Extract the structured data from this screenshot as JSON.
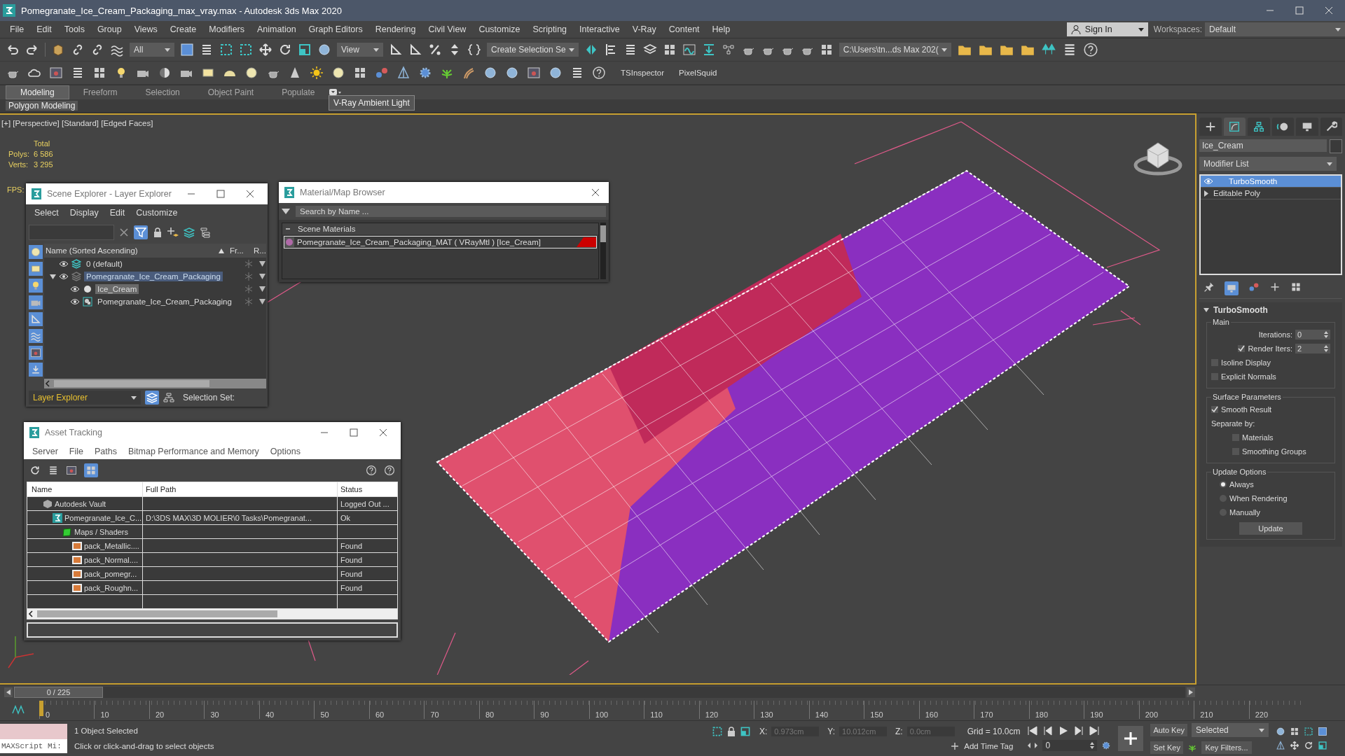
{
  "window": {
    "title": "Pomegranate_Ice_Cream_Packaging_max_vray.max - Autodesk 3ds Max 2020"
  },
  "menu": [
    "File",
    "Edit",
    "Tools",
    "Group",
    "Views",
    "Create",
    "Modifiers",
    "Animation",
    "Graph Editors",
    "Rendering",
    "Civil View",
    "Customize",
    "Scripting",
    "Interactive",
    "V-Ray",
    "Content",
    "Help"
  ],
  "account": {
    "sign_in": "Sign In",
    "workspaces_label": "Workspaces:",
    "workspace": "Default"
  },
  "toolbar": {
    "selection_filter": "All",
    "reference_coord": "View",
    "named_selection": "Create Selection Se",
    "project_path": "C:\\Users\\tn...ds Max 202("
  },
  "toolbar2_labels": [
    "TSInspector",
    "PixelSquid"
  ],
  "ribbon": {
    "tabs": [
      {
        "label": "Modeling",
        "selected": true
      },
      {
        "label": "Freeform",
        "selected": false
      },
      {
        "label": "Selection",
        "selected": false
      },
      {
        "label": "Object Paint",
        "selected": false
      },
      {
        "label": "Populate",
        "selected": false
      }
    ],
    "panel": "Polygon Modeling"
  },
  "tooltip": "V-Ray Ambient Light",
  "viewport": {
    "label": "[+] [Perspective] [Standard] [Edged Faces]",
    "stats": {
      "total": "Total",
      "polys_label": "Polys:",
      "polys": "6 586",
      "verts_label": "Verts:",
      "verts": "3 295",
      "fps_label": "FPS:"
    }
  },
  "scene_explorer": {
    "title": "Scene Explorer - Layer Explorer",
    "menu": [
      "Select",
      "Display",
      "Edit",
      "Customize"
    ],
    "columns": [
      "Name (Sorted Ascending)",
      "Fr...",
      "R..."
    ],
    "tree": [
      {
        "label": "0 (default)",
        "kind": "layer",
        "selected": false
      },
      {
        "label": "Pomegranate_Ice_Cream_Packaging",
        "kind": "layer",
        "selected": true,
        "expanded": true,
        "children": [
          {
            "label": "Ice_Cream",
            "kind": "object",
            "selected": true
          },
          {
            "label": "Pomegranate_Ice_Cream_Packaging",
            "kind": "group",
            "selected": false
          }
        ]
      }
    ],
    "explorer": "Layer Explorer",
    "selection_set": "Selection Set:"
  },
  "material_browser": {
    "title": "Material/Map Browser",
    "search_placeholder": "Search by Name ...",
    "group": "Scene Materials",
    "materials": [
      "Pomegranate_Ice_Cream_Packaging_MAT ( VRayMtl ) [Ice_Cream]"
    ]
  },
  "asset_tracking": {
    "title": "Asset Tracking",
    "menu": [
      "Server",
      "File",
      "Paths",
      "Bitmap Performance and Memory",
      "Options"
    ],
    "columns": [
      "Name",
      "Full Path",
      "Status"
    ],
    "rows": [
      {
        "name": "Autodesk Vault",
        "kind": "vault",
        "status": "Logged Out ...",
        "children": [
          {
            "name": "Pomegranate_Ice_C...",
            "kind": "scene",
            "path": "D:\\3DS MAX\\3D MOLIER\\0 Tasks\\Pomegranat...",
            "status": "Ok",
            "children": [
              {
                "name": "Maps / Shaders",
                "kind": "folder",
                "children": [
                  {
                    "name": "pack_Metallic....",
                    "kind": "bitmap",
                    "status": "Found"
                  },
                  {
                    "name": "pack_Normal....",
                    "kind": "bitmap",
                    "status": "Found"
                  },
                  {
                    "name": "pack_pomegr...",
                    "kind": "bitmap",
                    "status": "Found"
                  },
                  {
                    "name": "pack_Roughn...",
                    "kind": "bitmap",
                    "status": "Found"
                  }
                ]
              }
            ]
          }
        ]
      }
    ]
  },
  "command_panel": {
    "object_name": "Ice_Cream",
    "modifier_list": "Modifier List",
    "stack": [
      {
        "label": "TurboSmooth",
        "kind": "modifier",
        "selected": true
      },
      {
        "label": "Editable Poly",
        "kind": "base",
        "selected": false
      }
    ],
    "rollout": {
      "title": "TurboSmooth",
      "main": "Main",
      "iterations_label": "Iterations:",
      "iterations": "0",
      "render_iters": {
        "label": "Render Iters:",
        "checked": true,
        "value": "2"
      },
      "options": [
        {
          "label": "Isoline Display",
          "checked": false
        },
        {
          "label": "Explicit Normals",
          "checked": false
        }
      ],
      "surface": "Surface Parameters",
      "smooth_result": {
        "label": "Smooth Result",
        "checked": true
      },
      "separate_by": "Separate by:",
      "separate": [
        {
          "label": "Materials",
          "checked": false
        },
        {
          "label": "Smoothing Groups",
          "checked": false
        }
      ],
      "update_options": "Update Options",
      "update_modes": [
        {
          "label": "Always",
          "selected": true
        },
        {
          "label": "When Rendering",
          "selected": false
        },
        {
          "label": "Manually",
          "selected": false
        }
      ],
      "update_button": "Update"
    }
  },
  "timeline": {
    "frame": "0 / 225",
    "level": 0,
    "ticks": [
      "0",
      "10",
      "20",
      "30",
      "40",
      "50",
      "60",
      "70",
      "80",
      "90",
      "100",
      "110",
      "120",
      "130",
      "140",
      "150",
      "160",
      "170",
      "180",
      "190",
      "200",
      "210",
      "220"
    ]
  },
  "status": {
    "maxscript": "MAXScript Mi:",
    "selected": "1 Object Selected",
    "prompt": "Click or click-and-drag to select objects",
    "x_label": "X:",
    "x": "0.973cm",
    "y_label": "Y:",
    "y": "10.012cm",
    "z_label": "Z:",
    "z": "0.0cm",
    "grid": "Grid = 10.0cm",
    "add_time_tag": "Add Time Tag",
    "auto_key": "Auto Key",
    "set_key": "Set Key",
    "key_mode": "Selected",
    "key_filters": "Key Filters...",
    "current_frame": "0"
  }
}
